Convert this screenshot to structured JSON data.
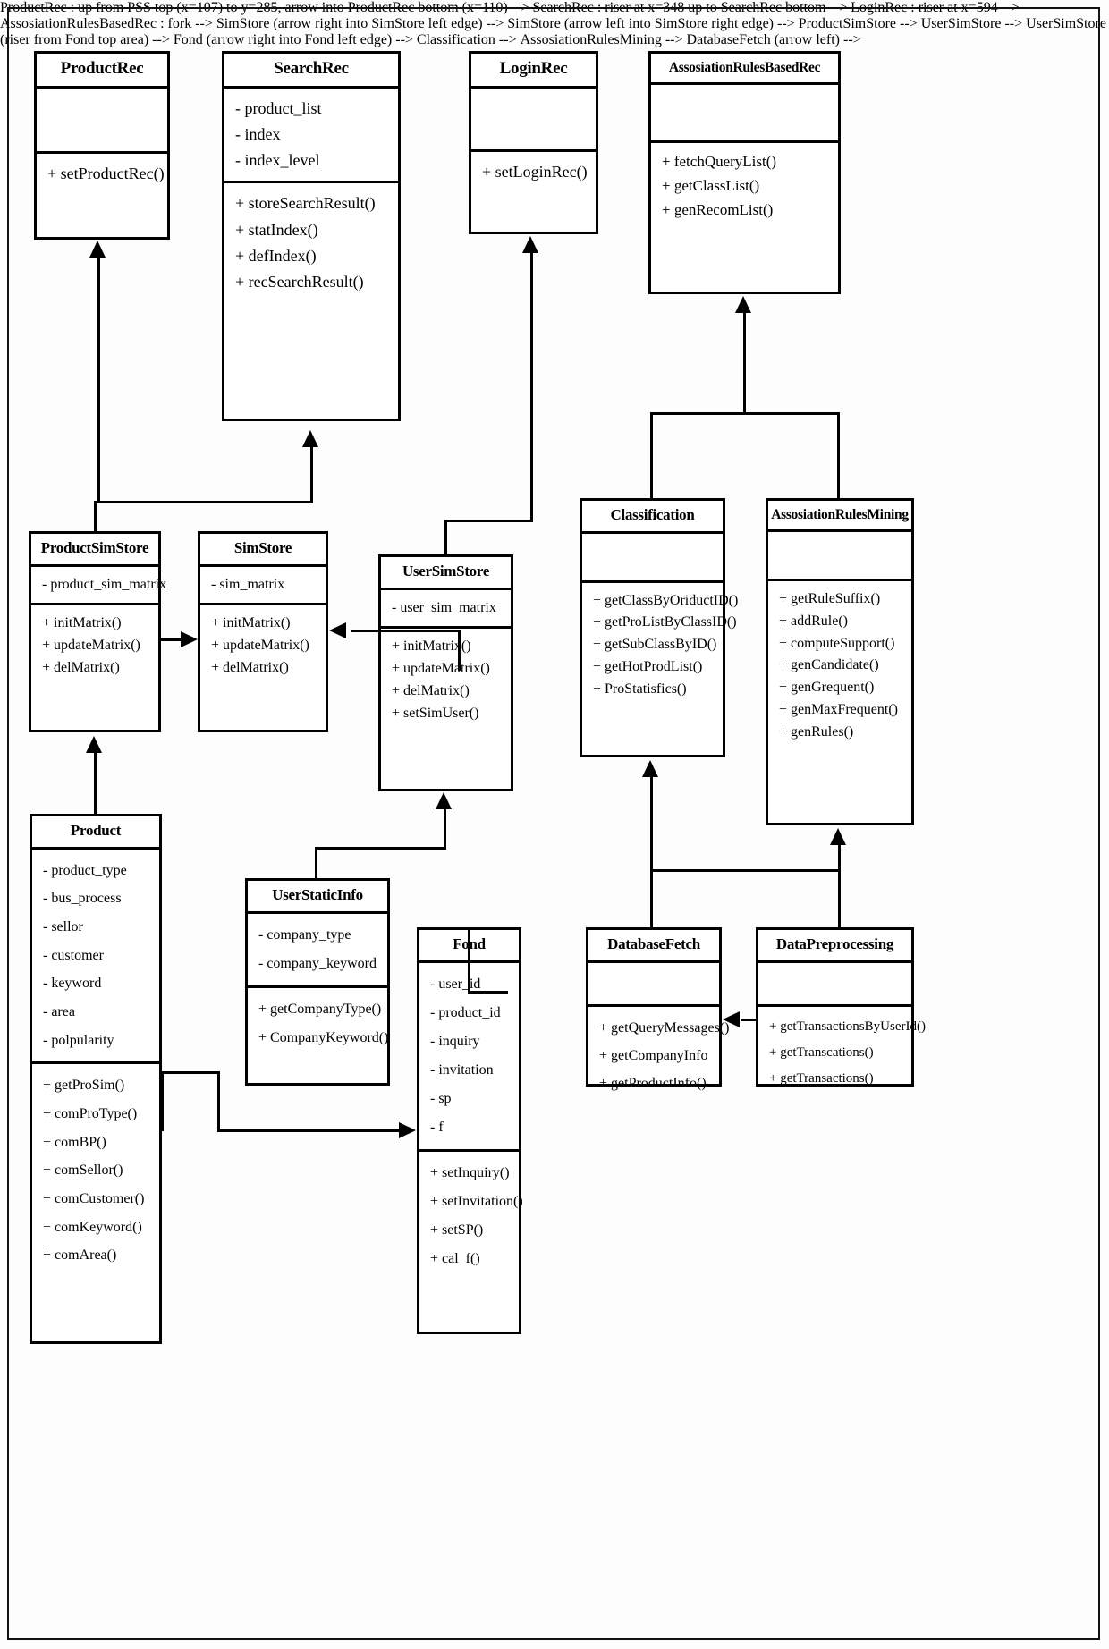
{
  "diagram": {
    "type": "uml-class-diagram",
    "classes": [
      {
        "id": "productrec",
        "name": "ProductRec",
        "attributes": [],
        "operations": [
          "+ setProductRec()"
        ]
      },
      {
        "id": "searchrec",
        "name": "SearchRec",
        "attributes": [
          "- product_list",
          "- index",
          "- index_level"
        ],
        "operations": [
          "+ storeSearchResult()",
          "+ statIndex()",
          "+ defIndex()",
          "+ recSearchResult()"
        ]
      },
      {
        "id": "loginrec",
        "name": "LoginRec",
        "attributes": [],
        "operations": [
          "+ setLoginRec()"
        ]
      },
      {
        "id": "assosiationrulesbasedrec",
        "name": "AssosiationRulesBasedRec",
        "attributes": [],
        "operations": [
          "+ fetchQueryList()",
          "+ getClassList()",
          "+ genRecomList()"
        ]
      },
      {
        "id": "productsimstore",
        "name": "ProductSimStore",
        "attributes": [
          "- product_sim_matrix"
        ],
        "operations": [
          "+ initMatrix()",
          "+ updateMatrix()",
          "+ delMatrix()"
        ]
      },
      {
        "id": "simstore",
        "name": "SimStore",
        "attributes": [
          "- sim_matrix"
        ],
        "operations": [
          "+ initMatrix()",
          "+ updateMatrix()",
          "+ delMatrix()"
        ]
      },
      {
        "id": "usersimstore",
        "name": "UserSimStore",
        "attributes": [
          "- user_sim_matrix"
        ],
        "operations": [
          "+ initMatrix()",
          "+ updateMatrix()",
          "+ delMatrix()",
          "+ setSimUser()"
        ]
      },
      {
        "id": "classification",
        "name": "Classification",
        "attributes": [],
        "operations": [
          "+ getClassByOriductID()",
          "+ getProListByClassID()",
          "+ getSubClassByID()",
          "+ getHotProdList()",
          "+ ProStatisfics()"
        ]
      },
      {
        "id": "assosiationrulesmining",
        "name": "AssosiationRulesMining",
        "attributes": [],
        "operations": [
          "+ getRuleSuffix()",
          "+ addRule()",
          "+ computeSupport()",
          "+ genCandidate()",
          "+ genGrequent()",
          "+ genMaxFrequent()",
          "+ genRules()"
        ]
      },
      {
        "id": "product",
        "name": "Product",
        "attributes": [
          "- product_type",
          "- bus_process",
          "- sellor",
          "- customer",
          "- keyword",
          "- area",
          "- polpularity"
        ],
        "operations": [
          "+ getProSim()",
          "+ comProType()",
          "+ comBP()",
          "+ comSellor()",
          "+ comCustomer()",
          "+ comKeyword()",
          "+ comArea()"
        ]
      },
      {
        "id": "userstaticinfo",
        "name": "UserStaticInfo",
        "attributes": [
          "- company_type",
          "- company_keyword"
        ],
        "operations": [
          "+ getCompanyType()",
          "+ CompanyKeyword()"
        ]
      },
      {
        "id": "fond",
        "name": "Fond",
        "attributes": [
          "- user_id",
          "- product_id",
          "- inquiry",
          "- invitation",
          "- sp",
          "- f"
        ],
        "operations": [
          "+ setInquiry()",
          "+ setInvitation()",
          "+ setSP()",
          "+ cal_f()"
        ]
      },
      {
        "id": "databasefetch",
        "name": "DatabaseFetch",
        "attributes": [],
        "operations": [
          "+ getQueryMessages()",
          "+ getCompanyInfo",
          "+ getProductInfo()"
        ]
      },
      {
        "id": "datapreprocessing",
        "name": "DataPreprocessing",
        "attributes": [],
        "operations": [
          "+ getTransactionsByUserId()",
          "+ getTranscations()",
          "+ getTransactions()"
        ]
      }
    ]
  }
}
